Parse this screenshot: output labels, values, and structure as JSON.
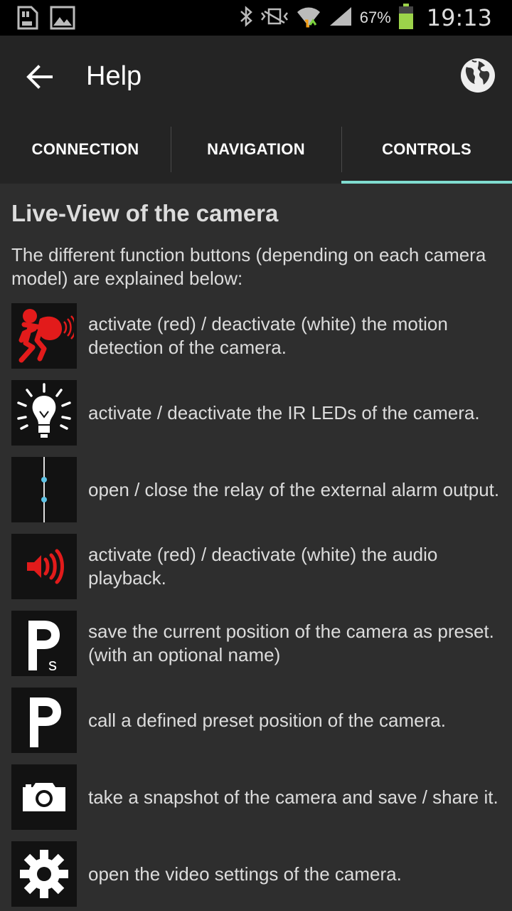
{
  "status_bar": {
    "battery_percent": "67%",
    "time": "19:13",
    "icons": [
      "sd-card-icon",
      "image-icon",
      "bluetooth-icon",
      "vibrate-icon",
      "wifi-icon",
      "signal-icon",
      "battery-icon"
    ]
  },
  "appbar": {
    "title": "Help",
    "back_icon": "arrow-left-icon",
    "globe_icon": "globe-icon"
  },
  "tabs": [
    {
      "label": "CONNECTION",
      "active": false
    },
    {
      "label": "NAVIGATION",
      "active": false
    },
    {
      "label": "CONTROLS",
      "active": true
    }
  ],
  "accent_color": "#7fdcd0",
  "content": {
    "title": "Live-View of the camera",
    "intro": "The different function buttons (depending on each camera model) are explained below:",
    "items": [
      {
        "icon": "motion-detection-icon",
        "text": "activate (red) / deactivate (white) the motion detection of the camera."
      },
      {
        "icon": "ir-led-icon",
        "text": "activate / deactivate the IR LEDs of the camera."
      },
      {
        "icon": "relay-icon",
        "text": "open / close the relay of the external alarm output."
      },
      {
        "icon": "audio-playback-icon",
        "text": "activate (red) / deactivate (white) the audio playback."
      },
      {
        "icon": "save-preset-icon",
        "text": "save the current position of the camera as preset. (with an optional name)"
      },
      {
        "icon": "call-preset-icon",
        "text": "call a defined preset position of the camera."
      },
      {
        "icon": "snapshot-icon",
        "text": "take a snapshot of the camera and save / share it."
      },
      {
        "icon": "video-settings-icon",
        "text": "open the video settings of the camera."
      }
    ]
  }
}
